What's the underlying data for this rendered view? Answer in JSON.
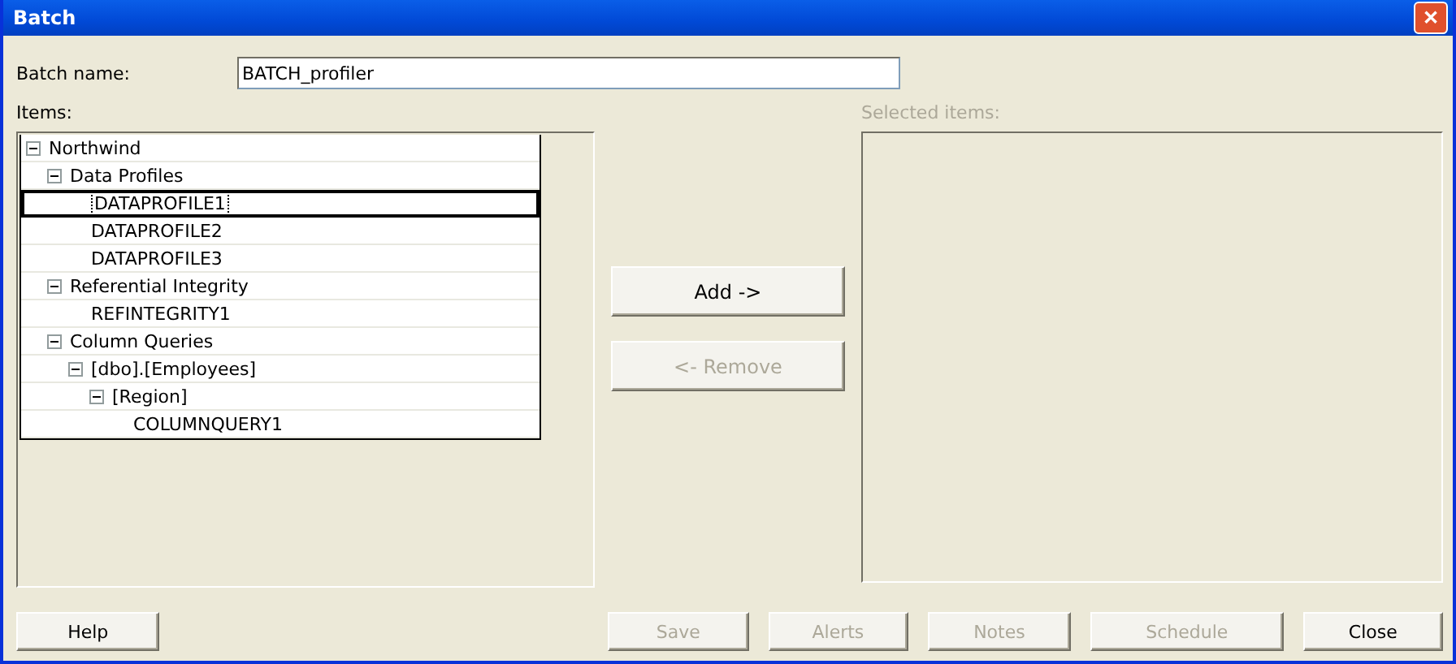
{
  "window": {
    "title": "Batch",
    "close": "✕"
  },
  "batch_name": {
    "label": "Batch name:",
    "value": "BATCH_profiler"
  },
  "items": {
    "label": "Items:",
    "tree": [
      {
        "label": "Northwind",
        "expanded": true,
        "selected": false,
        "children": [
          {
            "label": "Data Profiles",
            "expanded": true,
            "selected": false,
            "children": [
              {
                "label": "DATAPROFILE1",
                "selected": true
              },
              {
                "label": "DATAPROFILE2",
                "selected": false
              },
              {
                "label": "DATAPROFILE3",
                "selected": false
              }
            ]
          },
          {
            "label": "Referential Integrity",
            "expanded": true,
            "selected": false,
            "children": [
              {
                "label": "REFINTEGRITY1",
                "selected": false
              }
            ]
          },
          {
            "label": "Column Queries",
            "expanded": true,
            "selected": false,
            "children": [
              {
                "label": "[dbo].[Employees]",
                "expanded": true,
                "selected": false,
                "children": [
                  {
                    "label": "[Region]",
                    "expanded": true,
                    "selected": false,
                    "children": [
                      {
                        "label": "COLUMNQUERY1",
                        "selected": false
                      }
                    ]
                  }
                ]
              }
            ]
          }
        ]
      }
    ]
  },
  "move_buttons": [
    {
      "label": "Add ->",
      "disabled": false
    },
    {
      "label": "<- Remove",
      "disabled": true
    }
  ],
  "selected_items": {
    "label": "Selected items:",
    "disabled": true
  },
  "footer_buttons": [
    {
      "label": "Help",
      "disabled": false
    },
    {
      "label": "Save",
      "disabled": true
    },
    {
      "label": "Alerts",
      "disabled": true
    },
    {
      "label": "Notes",
      "disabled": true
    },
    {
      "label": "Schedule",
      "disabled": true
    },
    {
      "label": "Close",
      "disabled": false
    }
  ]
}
